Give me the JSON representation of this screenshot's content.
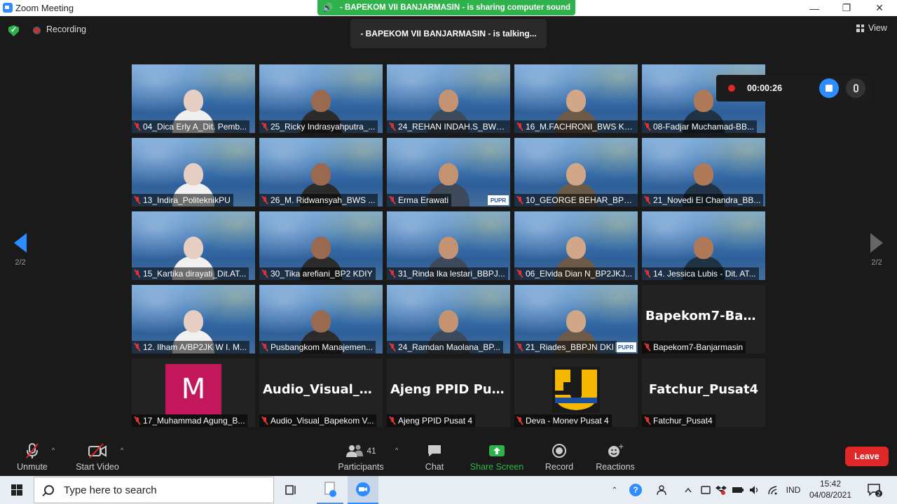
{
  "window": {
    "title": "Zoom Meeting",
    "minimize": "—",
    "restore": "❐",
    "close": "✕"
  },
  "sharing_banner": "- BAPEKOM VII BANJARMASIN - is sharing computer sound",
  "top": {
    "recording_label": "Recording",
    "talking": "- BAPEKOM VII BANJARMASIN - is talking...",
    "view_label": "View"
  },
  "pagination": {
    "left": "2/2",
    "right": "2/2"
  },
  "recording_panel": {
    "time": "00:00:26"
  },
  "tiles": [
    {
      "name": "04_Dica Erly A_Dit. Pemb...",
      "type": "video"
    },
    {
      "name": "25_Ricky Indrasyahputra_...",
      "type": "video"
    },
    {
      "name": "24_REHAN INDAH.S_BWS...",
      "type": "video"
    },
    {
      "name": "16_M.FACHRONI_BWS KA...",
      "type": "video"
    },
    {
      "name": "08-Fadjar Muchamad-BB...",
      "type": "video"
    },
    {
      "name": "13_Indira_PoliteknikPU",
      "type": "video"
    },
    {
      "name": "26_M. Ridwansyah_BWS ...",
      "type": "video"
    },
    {
      "name": "Erma Erawati",
      "type": "video",
      "badge": "PUPR"
    },
    {
      "name": "10_GEORGE BEHAR_BP2N...",
      "type": "video"
    },
    {
      "name": "21_Novedi El Chandra_BB...",
      "type": "video"
    },
    {
      "name": "15_Kartika dirayati_Dit.AT...",
      "type": "video"
    },
    {
      "name": "30_Tika arefiani_BP2 KDIY",
      "type": "video"
    },
    {
      "name": "31_Rinda Ika lestari_BBPJ...",
      "type": "video"
    },
    {
      "name": "06_Elvida Dian N_BP2JKJ...",
      "type": "video"
    },
    {
      "name": "14. Jessica Lubis - Dit. AT...",
      "type": "video"
    },
    {
      "name": "12. Ilham A/BP2JK W I. M...",
      "type": "video"
    },
    {
      "name": "Pusbangkom Manajemen...",
      "type": "video"
    },
    {
      "name": "24_Ramdan Maolana_BP...",
      "type": "video"
    },
    {
      "name": "21_Riades_BBPJN DKI",
      "type": "video",
      "badge": "PUPR"
    },
    {
      "name": "Bapekom7-Banjarmasin",
      "type": "off",
      "big": "Bapekom7-Banj..."
    },
    {
      "name": "17_Muhammad Agung_B...",
      "type": "avatar",
      "letter": "M"
    },
    {
      "name": "Audio_Visual_Bapekom V...",
      "type": "off",
      "big": "Audio_Visual_B..."
    },
    {
      "name": "Ajeng PPID Pusat 4",
      "type": "off",
      "big": "Ajeng PPID Pus..."
    },
    {
      "name": "Deva - Monev Pusat 4",
      "type": "logo"
    },
    {
      "name": "Fatchur_Pusat4",
      "type": "off",
      "big": "Fatchur_Pusat4"
    }
  ],
  "toolbar": {
    "unmute": "Unmute",
    "start_video": "Start Video",
    "participants": "Participants",
    "participant_count": "41",
    "chat": "Chat",
    "share_screen": "Share Screen",
    "record": "Record",
    "reactions": "Reactions",
    "leave": "Leave"
  },
  "taskbar": {
    "search_placeholder": "Type here to search",
    "lang": "IND",
    "time": "15:42",
    "date": "04/08/2021",
    "notif_count": "2",
    "help": "?"
  },
  "colors": {
    "accent": "#2d8cff",
    "green": "#2fb24c",
    "leave": "#e02828",
    "bg": "#1a1a1a"
  }
}
